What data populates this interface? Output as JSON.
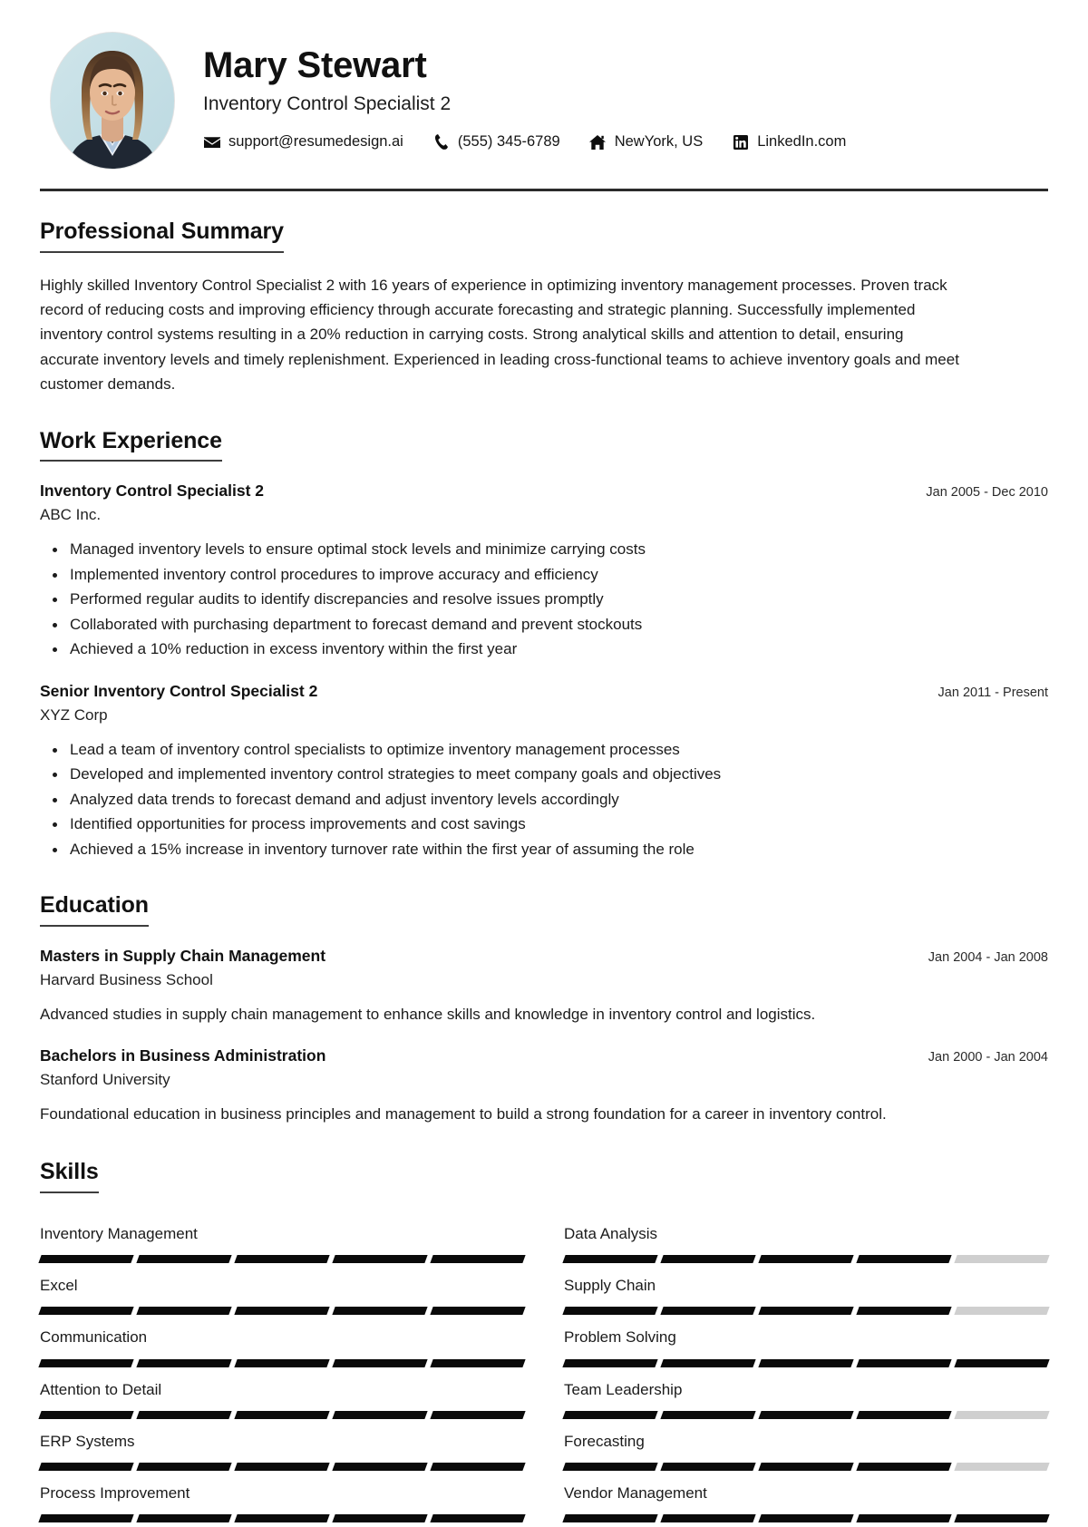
{
  "header": {
    "name": "Mary Stewart",
    "job_title": "Inventory Control Specialist 2",
    "avatar_alt": "profile-photo",
    "contacts": [
      {
        "icon": "envelope-icon",
        "label": "support@resumedesign.ai"
      },
      {
        "icon": "phone-icon",
        "label": "(555) 345-6789"
      },
      {
        "icon": "home-icon",
        "label": "NewYork, US"
      },
      {
        "icon": "linkedin-icon",
        "label": "LinkedIn.com"
      }
    ]
  },
  "summary": {
    "title": "Professional Summary",
    "text": "Highly skilled Inventory Control Specialist 2 with 16 years of experience in optimizing inventory management processes. Proven track record of reducing costs and improving efficiency through accurate forecasting and strategic planning. Successfully implemented inventory control systems resulting in a 20% reduction in carrying costs. Strong analytical skills and attention to detail, ensuring accurate inventory levels and timely replenishment. Experienced in leading cross-functional teams to achieve inventory goals and meet customer demands."
  },
  "work": {
    "title": "Work Experience",
    "entries": [
      {
        "role": "Inventory Control Specialist 2",
        "organization": "ABC Inc.",
        "dates": "Jan 2005 - Dec 2010",
        "bullets": [
          "Managed inventory levels to ensure optimal stock levels and minimize carrying costs",
          "Implemented inventory control procedures to improve accuracy and efficiency",
          "Performed regular audits to identify discrepancies and resolve issues promptly",
          "Collaborated with purchasing department to forecast demand and prevent stockouts",
          "Achieved a 10% reduction in excess inventory within the first year"
        ]
      },
      {
        "role": "Senior Inventory Control Specialist 2",
        "organization": "XYZ Corp",
        "dates": "Jan 2011 - Present",
        "bullets": [
          "Lead a team of inventory control specialists to optimize inventory management processes",
          "Developed and implemented inventory control strategies to meet company goals and objectives",
          "Analyzed data trends to forecast demand and adjust inventory levels accordingly",
          "Identified opportunities for process improvements and cost savings",
          "Achieved a 15% increase in inventory turnover rate within the first year of assuming the role"
        ]
      }
    ]
  },
  "education": {
    "title": "Education",
    "entries": [
      {
        "degree": "Masters in Supply Chain Management",
        "school": "Harvard Business School",
        "dates": "Jan 2004 - Jan 2008",
        "description": "Advanced studies in supply chain management to enhance skills and knowledge in inventory control and logistics."
      },
      {
        "degree": "Bachelors in Business Administration",
        "school": "Stanford University",
        "dates": "Jan 2000 - Jan 2004",
        "description": "Foundational education in business principles and management to build a strong foundation for a career in inventory control."
      }
    ]
  },
  "skills": {
    "title": "Skills",
    "max_level": 5,
    "items": [
      {
        "label": "Inventory Management",
        "level": 5
      },
      {
        "label": "Data Analysis",
        "level": 4
      },
      {
        "label": "Excel",
        "level": 5
      },
      {
        "label": "Supply Chain",
        "level": 4
      },
      {
        "label": "Communication",
        "level": 5
      },
      {
        "label": "Problem Solving",
        "level": 5
      },
      {
        "label": "Attention to Detail",
        "level": 5
      },
      {
        "label": "Team Leadership",
        "level": 4
      },
      {
        "label": "ERP Systems",
        "level": 5
      },
      {
        "label": "Forecasting",
        "level": 4
      },
      {
        "label": "Process Improvement",
        "level": 5
      },
      {
        "label": "Vendor Management",
        "level": 5
      }
    ]
  },
  "colors": {
    "text": "#1b1b1b",
    "heading": "#111111",
    "rule": "#2b2b2b",
    "skill_filled": "#0a0a0a",
    "skill_empty": "#cfcfcf"
  }
}
